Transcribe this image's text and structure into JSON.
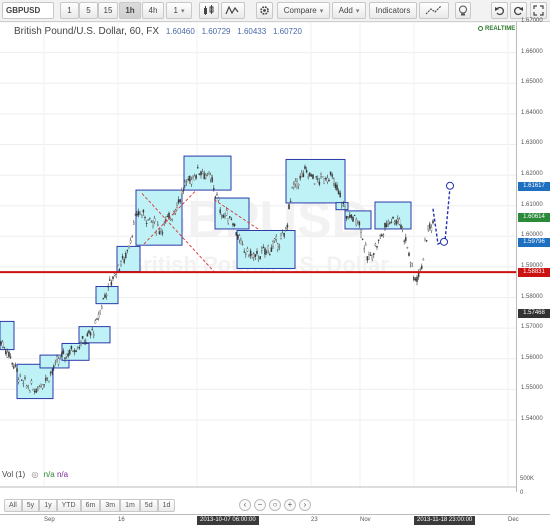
{
  "toolbar": {
    "symbol": "GBPUSD",
    "intervals": [
      "1",
      "5",
      "15",
      "1h",
      "4h",
      "1"
    ],
    "active_interval": "1h",
    "compare_label": "Compare",
    "add_label": "Add",
    "indicators_label": "Indicators"
  },
  "chart": {
    "instrument": "British Pound/U.S. Dollar, 60, FX",
    "ohlc": [
      "1.60460",
      "1.60729",
      "1.60433",
      "1.60720"
    ],
    "realtime_label": "REALTIME",
    "watermark": "GBPUSD",
    "watermark_sub": "British Pound/U.S. Dollar",
    "price_ticks": [
      "1.67000",
      "1.66000",
      "1.65000",
      "1.64000",
      "1.63000",
      "1.62000",
      "1.61000",
      "1.60000",
      "1.59000",
      "1.58000",
      "1.57000",
      "1.56000",
      "1.55000",
      "1.54000"
    ],
    "price_tags": [
      {
        "label": "1.61617",
        "value": 1.61617,
        "color": "#1e6fc0"
      },
      {
        "label": "1.60614",
        "value": 1.60614,
        "color": "#2a8a3a"
      },
      {
        "label": "1.59796",
        "value": 1.59796,
        "color": "#1e6fc0"
      },
      {
        "label": "1.58831",
        "value": 1.58831,
        "color": "#cc1111"
      },
      {
        "label": "1.57468",
        "value": 1.57468,
        "color": "#333333"
      }
    ],
    "support_level": 1.58831
  },
  "volume": {
    "legend": "Vol (1)",
    "na1": "n/a",
    "na2": "n/a",
    "ticks": [
      "500K",
      "0"
    ]
  },
  "range_buttons": [
    "All",
    "5y",
    "1y",
    "YTD",
    "6m",
    "3m",
    "1m",
    "5d",
    "1d"
  ],
  "time_axis": {
    "labels": [
      "Sep",
      "16",
      "23",
      "Nov",
      "Dec"
    ],
    "highlight_left": "2013-10-07 06:00:00",
    "highlight_right": "2013-11-18 23:00:00"
  },
  "colors": {
    "zone_fill": "#bff2f7",
    "zone_stroke": "#2b3aa8",
    "support_line": "#cc1111",
    "candle": "#3a3a3a"
  }
}
